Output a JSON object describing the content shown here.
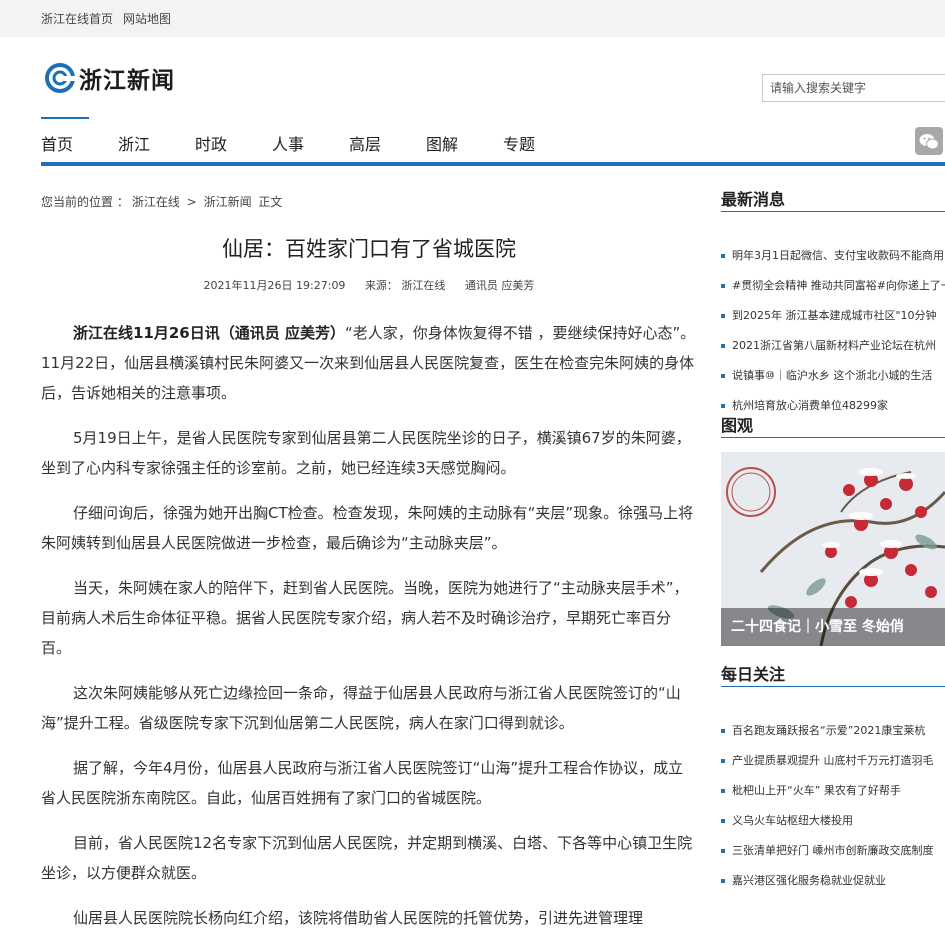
{
  "topbar": {
    "home_link": "浙江在线首页",
    "sitemap_link": "网站地图"
  },
  "header": {
    "logo_text": "浙江新闻",
    "search": {
      "placeholder": "请输入搜索关键字"
    }
  },
  "nav": {
    "items": [
      "首页",
      "浙江",
      "时政",
      "人事",
      "高层",
      "图解",
      "专题"
    ]
  },
  "breadcrumb": {
    "prefix": "您当前的位置 ：",
    "level1": "浙江在线",
    "sep": ">",
    "level2": "浙江新闻",
    "current": "正文"
  },
  "article": {
    "title": "仙居：百姓家门口有了省城医院",
    "date": "2021年11月26日 19:27:09",
    "source": "来源：  浙江在线",
    "author": "通讯员 应美芳",
    "lead_bold": "浙江在线11月26日讯（通讯员 应美芳）",
    "lead_rest": "“老人家，你身体恢复得不错 ，要继续保持好心态”。11月22日，仙居县横溪镇村民朱阿婆又一次来到仙居县人民医院复查，医生在检查完朱阿姨的身体后，告诉她相关的注意事项。",
    "paragraphs": [
      "5月19日上午，是省人民医院专家到仙居县第二人民医院坐诊的日子，横溪镇67岁的朱阿婆，坐到了心内科专家徐强主任的诊室前。之前，她已经连续3天感觉胸闷。",
      "仔细问询后，徐强为她开出胸CT检查。检查发现，朱阿姨的主动脉有“夹层”现象。徐强马上将朱阿姨转到仙居县人民医院做进一步检查，最后确诊为“主动脉夹层”。",
      "当天，朱阿姨在家人的陪伴下，赶到省人民医院。当晚，医院为她进行了“主动脉夹层手术”，目前病人术后生命体征平稳。据省人民医院专家介绍，病人若不及时确诊治疗，早期死亡率百分百。",
      "这次朱阿姨能够从死亡边缘捡回一条命，得益于仙居县人民政府与浙江省人民医院签订的“山海”提升工程。省级医院专家下沉到仙居第二人民医院，病人在家门口得到就诊。",
      "据了解，今年4月份，仙居县人民政府与浙江省人民医院签订“山海”提升工程合作协议，成立省人民医院浙东南院区。自此，仙居百姓拥有了家门口的省城医院。",
      "目前，省人民医院12名专家下沉到仙居人民医院，并定期到横溪、白塔、下各等中心镇卫生院坐诊，以方便群众就医。",
      "仙居县人民医院院长杨向红介绍，该院将借助省人民医院的托管优势，引进先进管理理"
    ]
  },
  "sidebar": {
    "latest": {
      "title": "最新消息",
      "items": [
        "明年3月1日起微信、支付宝收款码不能商用",
        "#贯彻全会精神 推动共同富裕#向你递上了一",
        "到2025年 浙江基本建成城市社区\"10分钟",
        "2021浙江省第八届新材料产业论坛在杭州",
        "说镇事⑩｜临沪水乡 这个浙北小城的生活",
        "杭州培育放心消费单位48299家"
      ]
    },
    "photos": {
      "title": "图观",
      "caption": "二十四食记｜小雪至 冬始俏"
    },
    "daily": {
      "title": "每日关注",
      "items": [
        "百名跑友踊跃报名“示爱”2021康宝莱杭",
        "产业提质暴观提升 山底村千万元打造羽毛",
        "枇杷山上开“火车” 果农有了好帮手",
        "义乌火车站枢纽大楼投用",
        "三张清单把好门 嵊州市创新廉政交底制度",
        "嘉兴港区强化服务稳就业促就业"
      ]
    }
  },
  "colors": {
    "brand_blue": "#1f6fb6",
    "topbar_bg": "#f3f3f3",
    "text": "#333333"
  },
  "icons": {
    "logo": "zhejiang-news-logo-icon",
    "wechat": "wechat-icon",
    "bullet": "square-bullet-icon"
  }
}
